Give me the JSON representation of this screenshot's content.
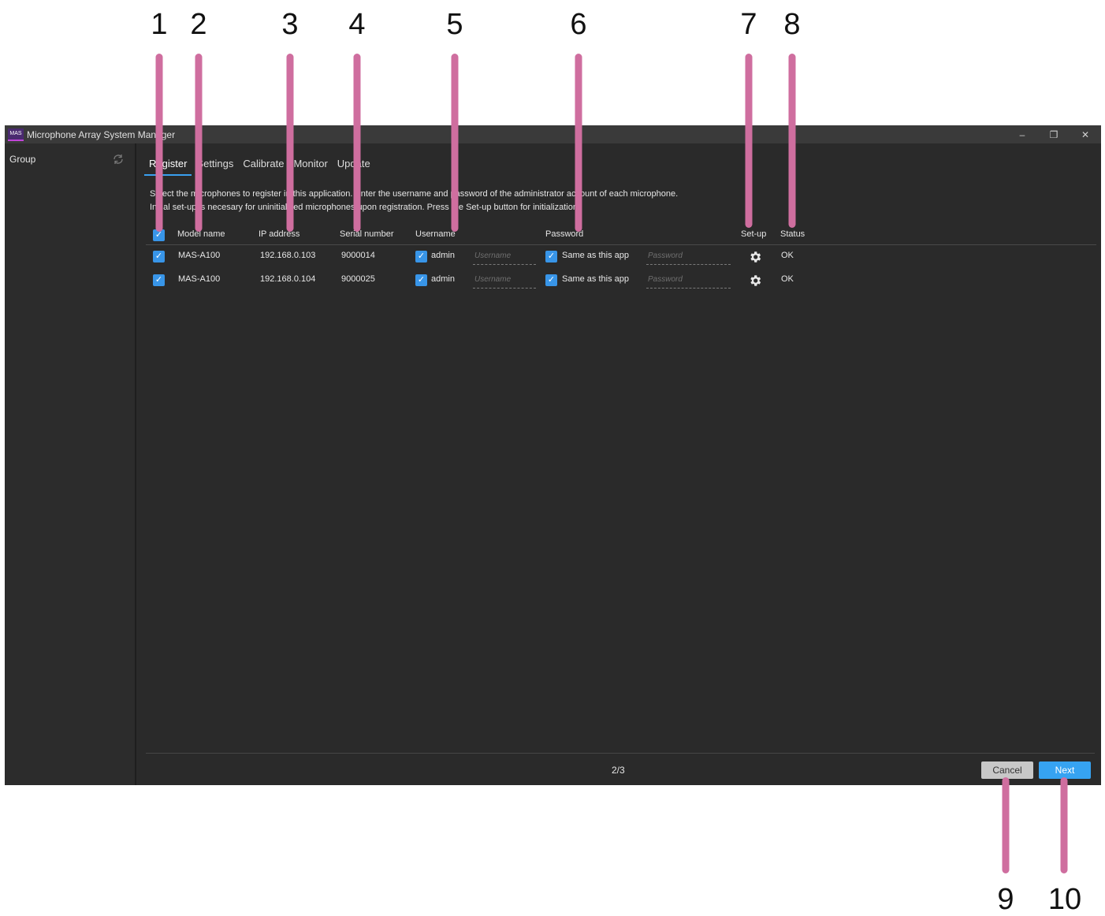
{
  "window": {
    "logo_text": "MAS",
    "title": "Microphone Array System Manager",
    "minimize": "–",
    "restore": "❐",
    "close": "✕"
  },
  "sidebar": {
    "group_label": "Group",
    "refresh_icon": "refresh-icon"
  },
  "tabs": [
    {
      "label": "Register",
      "active": true
    },
    {
      "label": "Settings",
      "active": false
    },
    {
      "label": "Calibrate",
      "active": false
    },
    {
      "label": "Monitor",
      "active": false
    },
    {
      "label": "Update",
      "active": false
    }
  ],
  "instructions": {
    "line1": "Select the microphones to register in this application. Enter the username and password of the administrator account of each microphone.",
    "line2": "Initial set-up is necesary for uninitialized microphones upon registration. Press the Set-up button for initialization."
  },
  "table": {
    "headers": {
      "model_name": "Model name",
      "ip_address": "IP address",
      "serial_number": "Serial number",
      "username": "Username",
      "password": "Password",
      "setup": "Set-up",
      "status": "Status"
    },
    "select_all_checked": true,
    "rows": [
      {
        "checked": true,
        "model_name": "MAS-A100",
        "ip_address": "192.168.0.103",
        "serial_number": "9000014",
        "username_default_checked": true,
        "username_default": "admin",
        "username_placeholder": "Username",
        "password_same_checked": true,
        "password_same_label": "Same as this app",
        "password_placeholder": "Password",
        "status": "OK"
      },
      {
        "checked": true,
        "model_name": "MAS-A100",
        "ip_address": "192.168.0.104",
        "serial_number": "9000025",
        "username_default_checked": true,
        "username_default": "admin",
        "username_placeholder": "Username",
        "password_same_checked": true,
        "password_same_label": "Same as this app",
        "password_placeholder": "Password",
        "status": "OK"
      }
    ]
  },
  "footer": {
    "page_indicator": "2/3",
    "cancel_label": "Cancel",
    "next_label": "Next"
  },
  "callouts": {
    "c1": "1",
    "c2": "2",
    "c3": "3",
    "c4": "4",
    "c5": "5",
    "c6": "6",
    "c7": "7",
    "c8": "8",
    "c9": "9",
    "c10": "10"
  },
  "colors": {
    "callout": "#cf6e9f",
    "accent": "#3895e8",
    "background": "#2a2a2a"
  },
  "checkmark": "✓"
}
